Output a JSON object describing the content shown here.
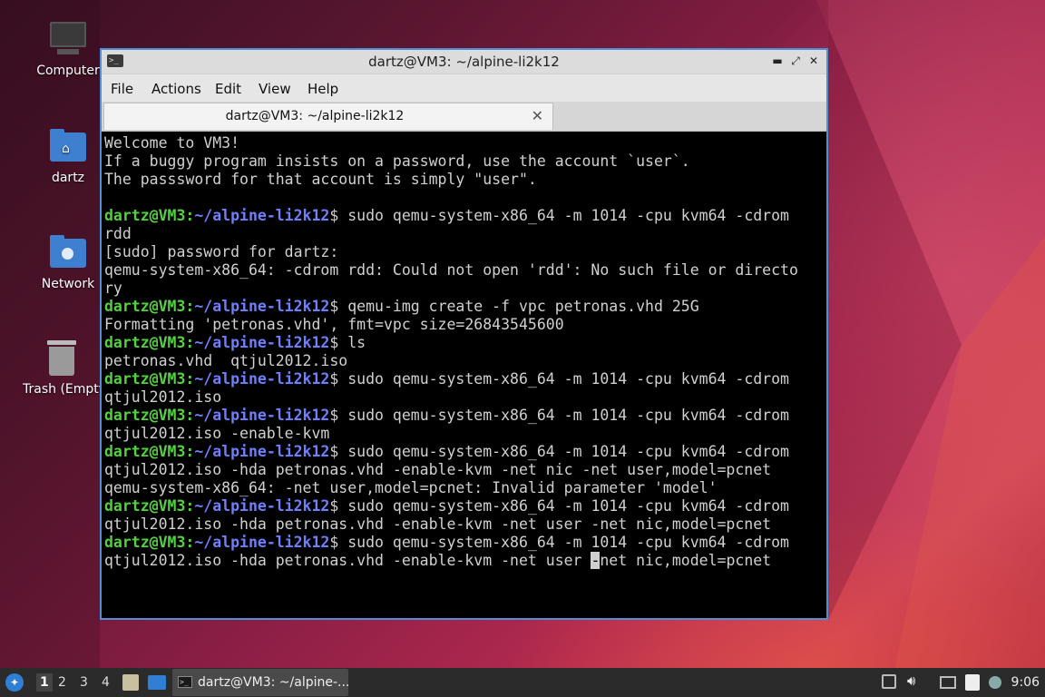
{
  "desktop": {
    "icons": [
      {
        "label": "Computer"
      },
      {
        "label": "dartz"
      },
      {
        "label": "Network"
      },
      {
        "label": "Trash (Empty)"
      }
    ]
  },
  "window": {
    "title": "dartz@VM3: ~/alpine-li2k12",
    "menu": [
      "File",
      "Actions",
      "Edit",
      "View",
      "Help"
    ],
    "tab_label": "dartz@VM3: ~/alpine-li2k12"
  },
  "terminal": {
    "prompt_user": "dartz@VM3",
    "prompt_path": "~/alpine-li2k12",
    "lines": [
      {
        "type": "out",
        "text": "Welcome to VM3!"
      },
      {
        "type": "out",
        "text": "If a buggy program insists on a password, use the account `user`."
      },
      {
        "type": "out",
        "text": "The passsword for that account is simply \"user\"."
      },
      {
        "type": "out",
        "text": ""
      },
      {
        "type": "cmd",
        "text": " sudo qemu-system-x86_64 -m 1014 -cpu kvm64 -cdrom"
      },
      {
        "type": "out",
        "text": "rdd"
      },
      {
        "type": "out",
        "text": "[sudo] password for dartz:"
      },
      {
        "type": "out",
        "text": "qemu-system-x86_64: -cdrom rdd: Could not open 'rdd': No such file or directo"
      },
      {
        "type": "out",
        "text": "ry"
      },
      {
        "type": "cmd",
        "text": " qemu-img create -f vpc petronas.vhd 25G"
      },
      {
        "type": "out",
        "text": "Formatting 'petronas.vhd', fmt=vpc size=26843545600"
      },
      {
        "type": "cmd",
        "text": " ls"
      },
      {
        "type": "out",
        "text": "petronas.vhd  qtjul2012.iso"
      },
      {
        "type": "cmd",
        "text": " sudo qemu-system-x86_64 -m 1014 -cpu kvm64 -cdrom"
      },
      {
        "type": "out",
        "text": "qtjul2012.iso"
      },
      {
        "type": "cmd",
        "text": " sudo qemu-system-x86_64 -m 1014 -cpu kvm64 -cdrom"
      },
      {
        "type": "out",
        "text": "qtjul2012.iso -enable-kvm"
      },
      {
        "type": "cmd",
        "text": " sudo qemu-system-x86_64 -m 1014 -cpu kvm64 -cdrom"
      },
      {
        "type": "out",
        "text": "qtjul2012.iso -hda petronas.vhd -enable-kvm -net nic -net user,model=pcnet"
      },
      {
        "type": "out",
        "text": "qemu-system-x86_64: -net user,model=pcnet: Invalid parameter 'model'"
      },
      {
        "type": "cmd",
        "text": " sudo qemu-system-x86_64 -m 1014 -cpu kvm64 -cdrom"
      },
      {
        "type": "out",
        "text": "qtjul2012.iso -hda petronas.vhd -enable-kvm -net user -net nic,model=pcnet"
      },
      {
        "type": "cmd",
        "text": " sudo qemu-system-x86_64 -m 1014 -cpu kvm64 -cdrom"
      },
      {
        "type": "cursorline",
        "before": "qtjul2012.iso -hda petronas.vhd -enable-kvm -net user ",
        "cursor": "-",
        "after": "net nic,model=pcnet"
      }
    ]
  },
  "taskbar": {
    "workspaces": [
      "1",
      "2",
      "3",
      "4"
    ],
    "active_workspace": "1",
    "task_label": "dartz@VM3: ~/alpine-...",
    "clock": "9:06"
  }
}
